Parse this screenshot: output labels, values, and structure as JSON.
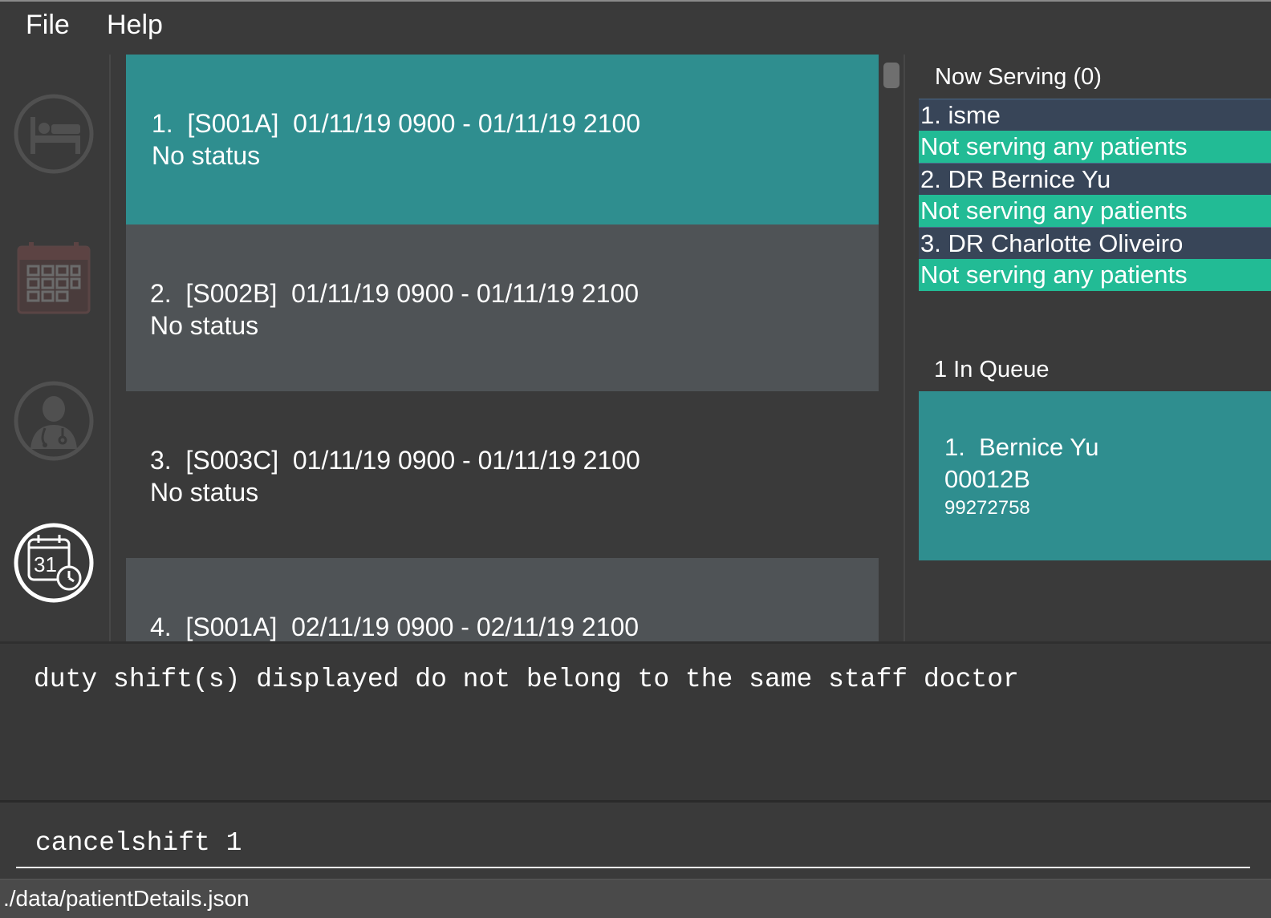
{
  "menu": {
    "file_label": "File",
    "help_label": "Help"
  },
  "sidebar": {
    "items": [
      {
        "icon": "bed-icon",
        "active": false
      },
      {
        "icon": "calendar-icon",
        "active": false
      },
      {
        "icon": "doctor-icon",
        "active": false
      },
      {
        "icon": "shift-schedule-icon",
        "label": "31",
        "active": true
      }
    ]
  },
  "shifts": [
    {
      "line1": "1.  [S001A]  01/11/19 0900 - 01/11/19 2100",
      "line2": "No status",
      "selected": true
    },
    {
      "line1": "2.  [S002B]  01/11/19 0900 - 01/11/19 2100",
      "line2": "No status",
      "selected": false
    },
    {
      "line1": "3.  [S003C]  01/11/19 0900 - 01/11/19 2100",
      "line2": "No status",
      "selected": false
    },
    {
      "line1": "4.  [S001A]  02/11/19 0900 - 02/11/19 2100",
      "line2": "",
      "selected": false
    }
  ],
  "now_serving": {
    "title": "Now Serving (0)",
    "rooms": [
      {
        "doctor": "1. isme",
        "status": "Not serving any patients"
      },
      {
        "doctor": "2. DR Bernice Yu",
        "status": "Not serving any patients"
      },
      {
        "doctor": "3. DR Charlotte Oliveiro",
        "status": "Not serving any patients"
      }
    ]
  },
  "queue": {
    "title": "1 In Queue",
    "entries": [
      {
        "name": "1.  Bernice Yu",
        "id": "00012B",
        "phone": "99272758"
      }
    ]
  },
  "result": {
    "message": "duty shift(s) displayed do not belong to the same staff doctor"
  },
  "command": {
    "value": "cancelshift 1"
  },
  "statusbar": {
    "path": "./data/patientDetails.json"
  },
  "colors": {
    "background": "#3a3a3a",
    "selected_card": "#2f8e8f",
    "card_light": "#4f5356",
    "card_dark": "#3a3a3a",
    "doctor_row": "#384558",
    "status_row": "#22bb95"
  }
}
